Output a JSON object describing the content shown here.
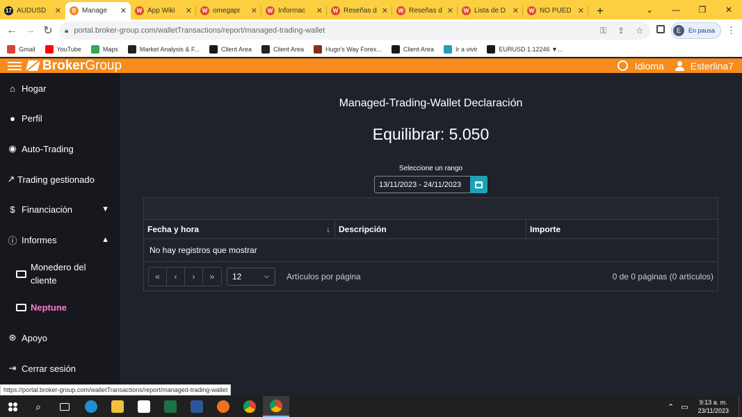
{
  "browser": {
    "tabs": [
      {
        "title": "AUDUSD",
        "fav": "tradingview-icon",
        "color": "#1a1a1a",
        "glyph": "17"
      },
      {
        "title": "Manage",
        "fav": "brokergroup-icon",
        "color": "#f58c1c",
        "glyph": "B"
      },
      {
        "title": "App Wiki",
        "fav": "wikifx-icon",
        "color": "#e04b2a",
        "glyph": "W"
      },
      {
        "title": "omegapr",
        "fav": "wikifx-icon",
        "color": "#e04b2a",
        "glyph": "W"
      },
      {
        "title": "Informac",
        "fav": "wikifx-icon",
        "color": "#e04b2a",
        "glyph": "W"
      },
      {
        "title": "Reseñas d",
        "fav": "wikifx-icon",
        "color": "#e04b2a",
        "glyph": "W"
      },
      {
        "title": "Reseñas d",
        "fav": "wikifx-icon",
        "color": "#e04b2a",
        "glyph": "W"
      },
      {
        "title": "Lista de D",
        "fav": "wikifx-icon",
        "color": "#e04b2a",
        "glyph": "W"
      },
      {
        "title": "NO PUED",
        "fav": "wikifx-icon",
        "color": "#e04b2a",
        "glyph": "W"
      }
    ],
    "url": "portal.broker-group.com/walletTransactions/report/managed-trading-wallet",
    "profile_label": "En pausa",
    "profile_initial": "E",
    "bookmarks": [
      {
        "label": "Gmail",
        "color": "#d44638"
      },
      {
        "label": "YouTube",
        "color": "#ff0000"
      },
      {
        "label": "Maps",
        "color": "#34a853"
      },
      {
        "label": "Market Analysis & F...",
        "color": "#222"
      },
      {
        "label": "Client Area",
        "color": "#1a1a1a"
      },
      {
        "label": "Client Area",
        "color": "#222"
      },
      {
        "label": "Hugo's Way Forex...",
        "color": "#8b2c1c"
      },
      {
        "label": "Client Area",
        "color": "#1a1a1a"
      },
      {
        "label": "Ir a vivir",
        "color": "#1fa2b5"
      },
      {
        "label": "EURUSD 1.12246 ▼...",
        "color": "#1a1a1a"
      }
    ],
    "status_url": "https://portal.broker-group.com/walletTransactions/report/managed-trading-wallet"
  },
  "topbar": {
    "logo_bold": "Broker",
    "logo_light": "Group",
    "language": "Idioma",
    "user": "Esterlina7"
  },
  "sidebar": {
    "items": [
      {
        "label": "Hogar",
        "icon": "home-icon"
      },
      {
        "label": "Perfil",
        "icon": "user-icon"
      },
      {
        "label": "Auto-Trading",
        "icon": "robot-icon"
      },
      {
        "label": "Trading gestionado",
        "icon": "trend-icon"
      },
      {
        "label": "Financiación",
        "icon": "money-icon"
      },
      {
        "label": "Informes",
        "icon": "info-icon"
      },
      {
        "label": "Apoyo",
        "icon": "support-icon"
      },
      {
        "label": "Cerrar sesión",
        "icon": "logout-icon"
      }
    ],
    "sub": [
      {
        "label": "Monedero del cliente"
      },
      {
        "label": "Neptune"
      }
    ],
    "active_color": "#ff7bd5"
  },
  "main": {
    "title": "Managed-Trading-Wallet Declaración",
    "balance": "Equilibrar: 5.050",
    "range_label": "Seleccione un rango",
    "range_value": "13/11/2023 - 24/11/2023",
    "columns": [
      "Fecha y hora",
      "Descripción",
      "Importe"
    ],
    "sort_indicator": "↓",
    "empty_text": "No hay registros que mostrar",
    "pager": {
      "buttons": [
        "«",
        "‹",
        "›",
        "»"
      ],
      "per_page": "12",
      "per_page_label": "Artículos por página",
      "info": "0 de 0 páginas (0 artículos)"
    }
  },
  "taskbar": {
    "time": "9:13 a. m.",
    "date": "23/11/2023"
  }
}
